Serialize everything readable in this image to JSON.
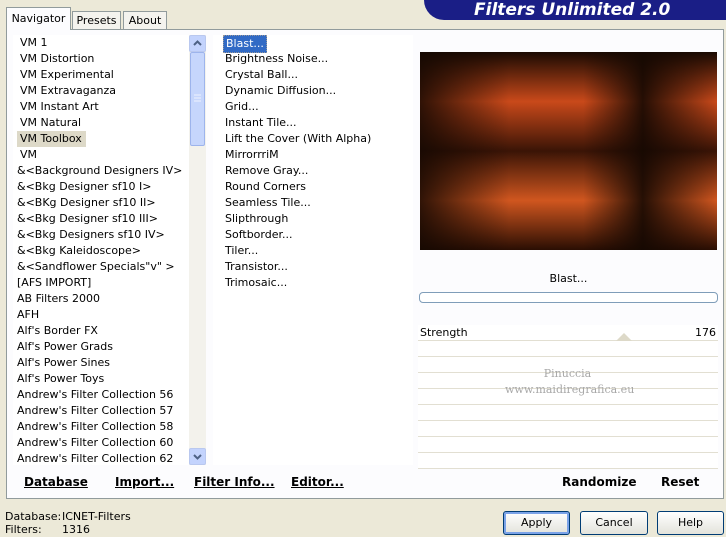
{
  "tabs": [
    "Navigator",
    "Presets",
    "About"
  ],
  "app_title": "Filters Unlimited 2.0",
  "categories": [
    "VM 1",
    "VM Distortion",
    "VM Experimental",
    "VM Extravaganza",
    "VM Instant Art",
    "VM Natural",
    "VM Toolbox",
    "VM",
    "&<Background Designers IV>",
    "&<Bkg Designer sf10 I>",
    "&<BKg Designer sf10 II>",
    "&<Bkg Designer sf10 III>",
    "&<Bkg Designers sf10 IV>",
    "&<Bkg Kaleidoscope>",
    "&<Sandflower Specials\"v\" >",
    "[AFS IMPORT]",
    "AB Filters 2000",
    "AFH",
    "Alf's Border FX",
    "Alf's Power Grads",
    "Alf's Power Sines",
    "Alf's Power Toys",
    "Andrew's Filter Collection 56",
    "Andrew's Filter Collection 57",
    "Andrew's Filter Collection 58",
    "Andrew's Filter Collection 60",
    "Andrew's Filter Collection 62"
  ],
  "selected_category": "VM Toolbox",
  "filters": [
    "Blast...",
    "Brightness Noise...",
    "Crystal Ball...",
    "Dynamic Diffusion...",
    "Grid...",
    "Instant Tile...",
    "Lift the Cover (With Alpha)",
    "MirrorrriM",
    "Remove Gray...",
    "Round Corners",
    "Seamless Tile...",
    "Slipthrough",
    "Softborder...",
    "Tiler...",
    "Transistor...",
    "Trimosaic..."
  ],
  "selected_filter": "Blast...",
  "preview": {
    "filter_name": "Blast...",
    "watermark_line1": "Pinuccia",
    "watermark_line2": "www.maidiregrafica.eu"
  },
  "params": [
    {
      "label": "Strength",
      "value": "176"
    }
  ],
  "left_buttons": [
    "Database",
    "Import...",
    "Filter Info...",
    "Editor..."
  ],
  "right_buttons": [
    "Randomize",
    "Reset"
  ],
  "status": {
    "database_label": "Database:",
    "database_value": "ICNET-Filters",
    "filters_label": "Filters:",
    "filters_value": "1316"
  },
  "dialog_buttons": {
    "apply": "Apply",
    "cancel": "Cancel",
    "help": "Help"
  },
  "colors": {
    "banner": "#1a1e86",
    "selection": "#316ac5",
    "preview_dark": "#1a0a02",
    "preview_orange": "#c9491a"
  }
}
